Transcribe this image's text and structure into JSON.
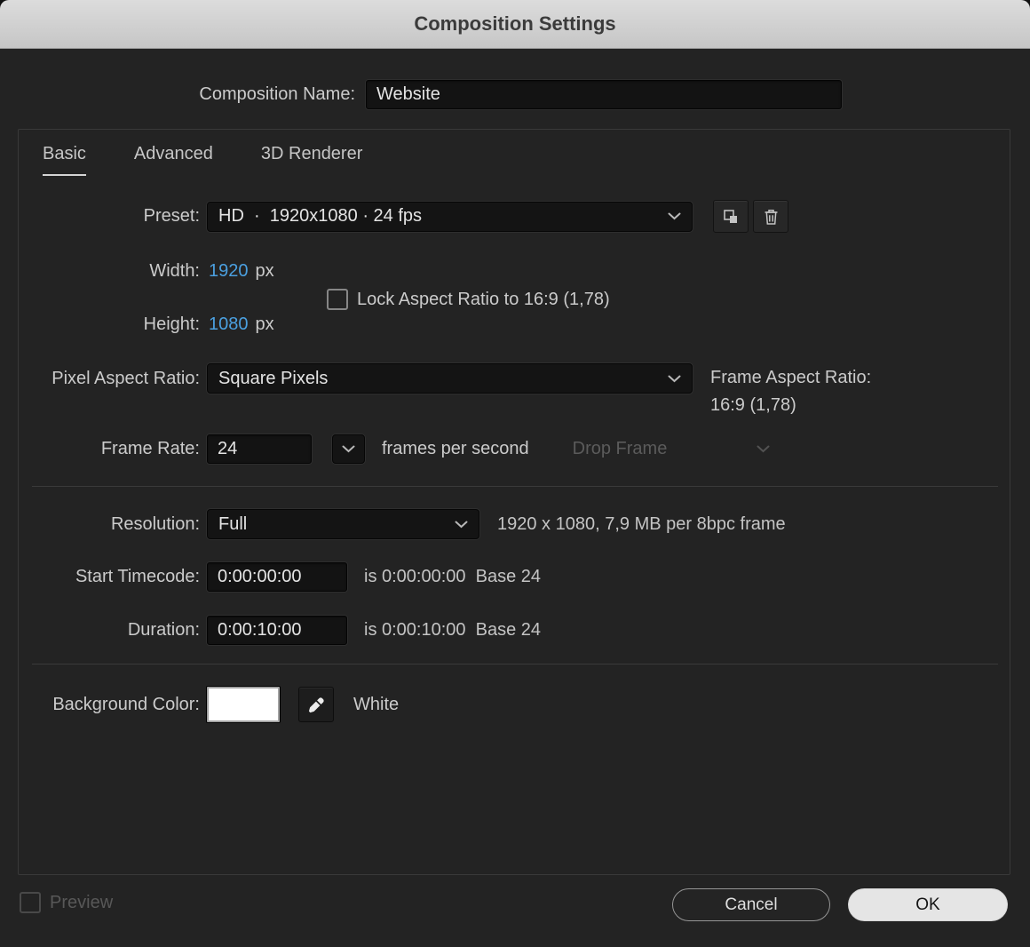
{
  "dialog": {
    "title": "Composition Settings"
  },
  "composition_name": {
    "label": "Composition Name:",
    "value": "Website"
  },
  "tabs": [
    {
      "id": "basic",
      "label": "Basic",
      "active": true
    },
    {
      "id": "advanced",
      "label": "Advanced",
      "active": false
    },
    {
      "id": "3d-renderer",
      "label": "3D Renderer",
      "active": false
    }
  ],
  "preset": {
    "label": "Preset:",
    "value": "HD  ·  1920x1080 · 24 fps"
  },
  "dimensions": {
    "width_label": "Width:",
    "width_value": "1920",
    "width_unit": "px",
    "height_label": "Height:",
    "height_value": "1080",
    "height_unit": "px",
    "lock_aspect_label": "Lock Aspect Ratio to 16:9 (1,78)",
    "lock_aspect_checked": false
  },
  "pixel_aspect_ratio": {
    "label": "Pixel Aspect Ratio:",
    "value": "Square Pixels",
    "frame_aspect_label": "Frame Aspect Ratio:",
    "frame_aspect_value": "16:9 (1,78)"
  },
  "frame_rate": {
    "label": "Frame Rate:",
    "value": "24",
    "unit": "frames per second",
    "drop_frame_value": "Drop Frame",
    "drop_frame_enabled": false
  },
  "resolution": {
    "label": "Resolution:",
    "value": "Full",
    "info": "1920 x 1080, 7,9 MB per 8bpc frame"
  },
  "start_timecode": {
    "label": "Start Timecode:",
    "value": "0:00:00:00",
    "info": "is 0:00:00:00  Base 24"
  },
  "duration": {
    "label": "Duration:",
    "value": "0:00:10:00",
    "info": "is 0:00:10:00  Base 24"
  },
  "background_color": {
    "label": "Background Color:",
    "color_name": "White",
    "color_hex": "#FFFFFF"
  },
  "footer": {
    "preview_label": "Preview",
    "preview_enabled": false,
    "cancel_label": "Cancel",
    "ok_label": "OK"
  },
  "icons": {
    "dropdown": "chevron-down",
    "preset_save": "save-preset",
    "preset_delete": "trash",
    "color_picker": "eyedropper"
  },
  "colors": {
    "accent_blue": "#4BA0E0",
    "dialog_background": "#232323",
    "titlebar_background": "#D4D4D4"
  }
}
